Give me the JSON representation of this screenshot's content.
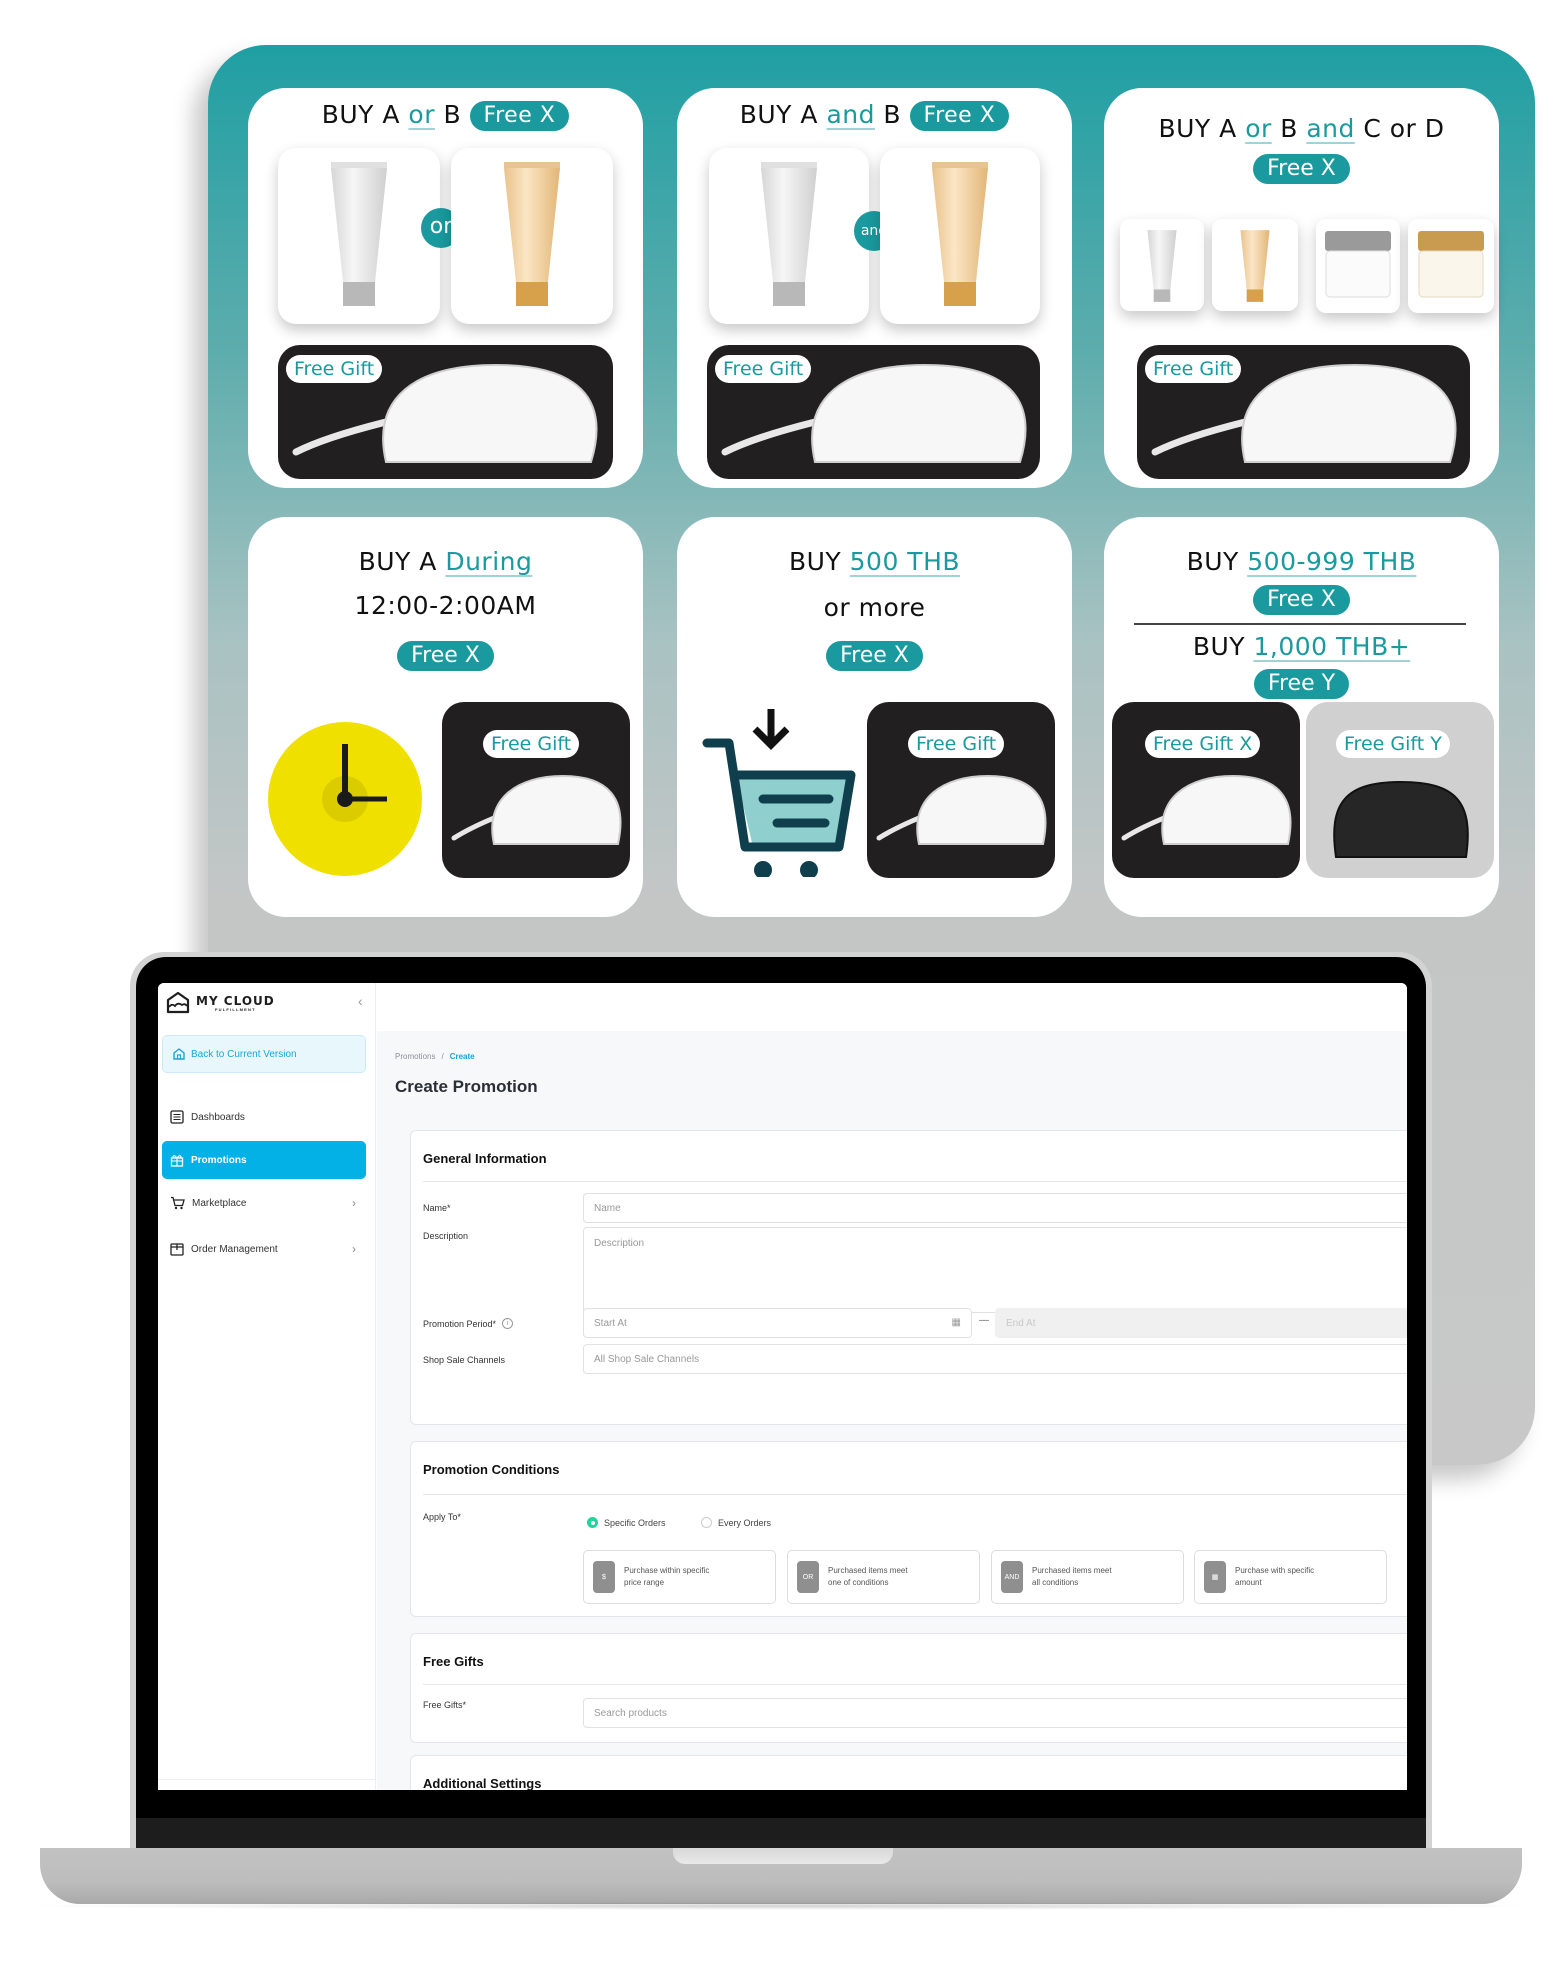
{
  "promo_panel": {
    "colors": {
      "accent": "#1a9a9e",
      "panel_top": "#1f9fa3",
      "panel_bottom": "#c8c8c8",
      "gift_bg": "#221f20",
      "clock_yellow": "#f0e000",
      "cart_dark": "#0f3f4d",
      "cart_fill": "#8fd0cf"
    },
    "cards": [
      {
        "headline_parts": [
          "BUY A ",
          "or",
          " B "
        ],
        "badge": "Free X",
        "connector": "or",
        "gift_tag": "Free Gift"
      },
      {
        "headline_parts": [
          "BUY A ",
          "and",
          " B "
        ],
        "badge": "Free X",
        "connector": "and",
        "gift_tag": "Free Gift"
      },
      {
        "headline_parts": [
          "BUY A ",
          "or",
          " B ",
          "and",
          " C or D"
        ],
        "badge": "Free X",
        "gift_tag": "Free Gift"
      },
      {
        "headline_parts": [
          "BUY A ",
          "During"
        ],
        "line2": "12:00-2:00AM",
        "badge": "Free X",
        "gift_tag": "Free Gift",
        "icon": "clock-icon"
      },
      {
        "headline_parts": [
          "BUY ",
          "500 THB"
        ],
        "line2": "or more",
        "badge": "Free X",
        "gift_tag": "Free Gift",
        "icon": "cart-icon"
      },
      {
        "tier1_parts": [
          "BUY ",
          "500-999 THB"
        ],
        "tier1_badge": "Free X",
        "tier2_parts": [
          "BUY ",
          "1,000 THB+"
        ],
        "tier2_badge": "Free Y",
        "gift_tag_x": "Free Gift X",
        "gift_tag_y": "Free Gift Y"
      }
    ]
  },
  "app": {
    "logo": {
      "title": "MY CLOUD",
      "subtitle": "FULFILLMENT"
    },
    "sidebar": {
      "collapse_icon": "‹",
      "back_button": "Back to Current Version",
      "items": [
        {
          "label": "Dashboards",
          "icon": "list-icon",
          "active": false
        },
        {
          "label": "Promotions",
          "icon": "gift-icon",
          "active": true
        },
        {
          "label": "Marketplace",
          "icon": "cart-icon",
          "active": false,
          "has_children": true
        },
        {
          "label": "Order Management",
          "icon": "box-icon",
          "active": false,
          "has_children": true
        }
      ],
      "chevron": "›"
    },
    "breadcrumb": {
      "parent": "Promotions",
      "separator": "/",
      "current": "Create"
    },
    "page_title": "Create Promotion",
    "general_info": {
      "title": "General Information",
      "name_label": "Name*",
      "name_placeholder": "Name",
      "description_label": "Description",
      "description_placeholder": "Description",
      "period_label": "Promotion Period*",
      "start_placeholder": "Start At",
      "end_placeholder": "End At",
      "range_separator": "—",
      "channels_label": "Shop Sale Channels",
      "channels_placeholder": "All Shop Sale Channels"
    },
    "conditions": {
      "title": "Promotion Conditions",
      "apply_label": "Apply To*",
      "options": [
        {
          "label": "Specific Orders",
          "selected": true
        },
        {
          "label": "Every Orders",
          "selected": false
        }
      ],
      "condition_types": [
        {
          "line1": "Purchase within specific",
          "line2": "price range",
          "icon": "money-icon",
          "glyph": "$"
        },
        {
          "line1": "Purchased items meet",
          "line2": "one of conditions",
          "icon": "or-icon",
          "glyph": "OR"
        },
        {
          "line1": "Purchased items meet",
          "line2": "all conditions",
          "icon": "and-icon",
          "glyph": "AND"
        },
        {
          "line1": "Purchase with specific",
          "line2": "amount",
          "icon": "boxes-icon",
          "glyph": "▦"
        }
      ]
    },
    "free_gifts": {
      "title": "Free Gifts",
      "label": "Free Gifts*",
      "placeholder": "Search products"
    },
    "additional": {
      "title": "Additional Settings"
    },
    "accent": "#03b1e6",
    "radio_on": "#20d49a"
  }
}
